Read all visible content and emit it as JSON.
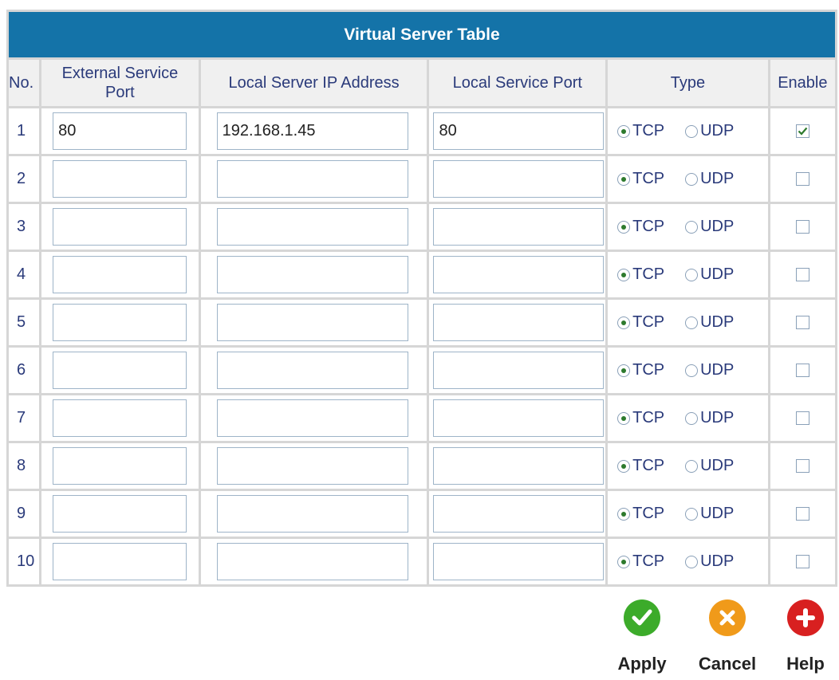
{
  "table": {
    "title": "Virtual Server Table",
    "headers": {
      "no": "No.",
      "external_port_line1": "External Service",
      "external_port_line2": "Port",
      "local_ip": "Local Server IP Address",
      "local_port": "Local Service Port",
      "type": "Type",
      "enable": "Enable"
    },
    "type_options": [
      "TCP",
      "UDP"
    ],
    "rows": [
      {
        "no": "1",
        "external_port": "80",
        "local_ip": "192.168.1.45",
        "local_port": "80",
        "type": "TCP",
        "enabled": true
      },
      {
        "no": "2",
        "external_port": "",
        "local_ip": "",
        "local_port": "",
        "type": "TCP",
        "enabled": false
      },
      {
        "no": "3",
        "external_port": "",
        "local_ip": "",
        "local_port": "",
        "type": "TCP",
        "enabled": false
      },
      {
        "no": "4",
        "external_port": "",
        "local_ip": "",
        "local_port": "",
        "type": "TCP",
        "enabled": false
      },
      {
        "no": "5",
        "external_port": "",
        "local_ip": "",
        "local_port": "",
        "type": "TCP",
        "enabled": false
      },
      {
        "no": "6",
        "external_port": "",
        "local_ip": "",
        "local_port": "",
        "type": "TCP",
        "enabled": false
      },
      {
        "no": "7",
        "external_port": "",
        "local_ip": "",
        "local_port": "",
        "type": "TCP",
        "enabled": false
      },
      {
        "no": "8",
        "external_port": "",
        "local_ip": "",
        "local_port": "",
        "type": "TCP",
        "enabled": false
      },
      {
        "no": "9",
        "external_port": "",
        "local_ip": "",
        "local_port": "",
        "type": "TCP",
        "enabled": false
      },
      {
        "no": "10",
        "external_port": "",
        "local_ip": "",
        "local_port": "",
        "type": "TCP",
        "enabled": false
      }
    ]
  },
  "actions": {
    "apply": {
      "label": "Apply",
      "icon": "check-icon",
      "color": "#3cab2a"
    },
    "cancel": {
      "label": "Cancel",
      "icon": "x-icon",
      "color": "#f09a1a"
    },
    "help": {
      "label": "Help",
      "icon": "plus-icon",
      "color": "#d82020"
    }
  },
  "colors": {
    "title_bar": "#1473a8",
    "header_text": "#2a3a7a",
    "grid": "#d6d6d6"
  }
}
